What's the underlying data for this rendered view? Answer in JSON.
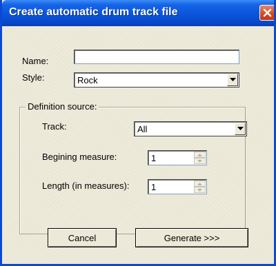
{
  "window": {
    "title": "Create automatic drum track file"
  },
  "form": {
    "name_label": "Name:",
    "name_value": "",
    "style_label": "Style:",
    "style_value": "Rock"
  },
  "definition_source": {
    "group_label": "Definition source:",
    "track_label": "Track:",
    "track_value": "All",
    "beginning_label": "Begining measure:",
    "beginning_value": "1",
    "length_label": "Length (in measures):",
    "length_value": "1"
  },
  "buttons": {
    "cancel": "Cancel",
    "generate": "Generate >>>"
  }
}
